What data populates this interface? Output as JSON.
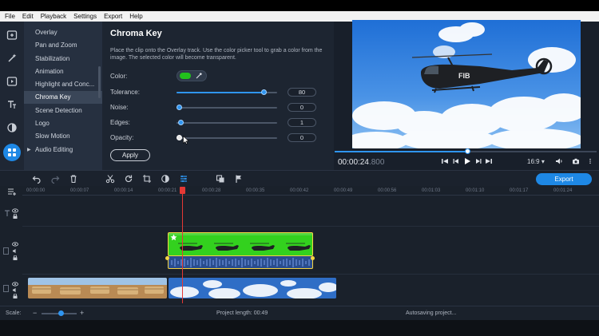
{
  "menu": [
    "File",
    "Edit",
    "Playback",
    "Settings",
    "Export",
    "Help"
  ],
  "categories": [
    {
      "label": "Overlay"
    },
    {
      "label": "Pan and Zoom"
    },
    {
      "label": "Stabilization"
    },
    {
      "label": "Animation"
    },
    {
      "label": "Highlight and Conc..."
    },
    {
      "label": "Chroma Key"
    },
    {
      "label": "Scene Detection"
    },
    {
      "label": "Logo"
    },
    {
      "label": "Slow Motion"
    },
    {
      "label": "Audio Editing"
    }
  ],
  "active_category": "Chroma Key",
  "panel": {
    "title": "Chroma Key",
    "description": "Place the clip onto the Overlay track. Use the color picker tool to grab a color from the image. The selected color will become transparent.",
    "color_label": "Color:",
    "selected_color": "#22c21c",
    "tolerance_label": "Tolerance:",
    "tolerance_value": "80",
    "noise_label": "Noise:",
    "noise_value": "0",
    "edges_label": "Edges:",
    "edges_value": "1",
    "opacity_label": "Opacity:",
    "opacity_value": "0",
    "apply_label": "Apply"
  },
  "preview": {
    "timecode": "00:00:24",
    "timecode_ms": ".800",
    "aspect": "16:9",
    "progress": 0.5,
    "helicopter_text": "FIB"
  },
  "toolbar": {
    "export_label": "Export"
  },
  "ruler_ticks": [
    "00:00:00",
    "00:00:07",
    "00:00:14",
    "00:00:21",
    "00:00:28",
    "00:00:35",
    "00:00:42",
    "00:00:49",
    "00:00:56",
    "00:01:03",
    "00:01:10",
    "00:01:17",
    "00:01:24"
  ],
  "status": {
    "scale_label": "Scale:",
    "project_length": "Project length: 00:49",
    "autosave": "Autosaving project..."
  },
  "colors": {
    "accent": "#1e88e5",
    "chroma_green": "#33d11e",
    "clip_border": "#f5d442",
    "playhead": "#e53935"
  }
}
